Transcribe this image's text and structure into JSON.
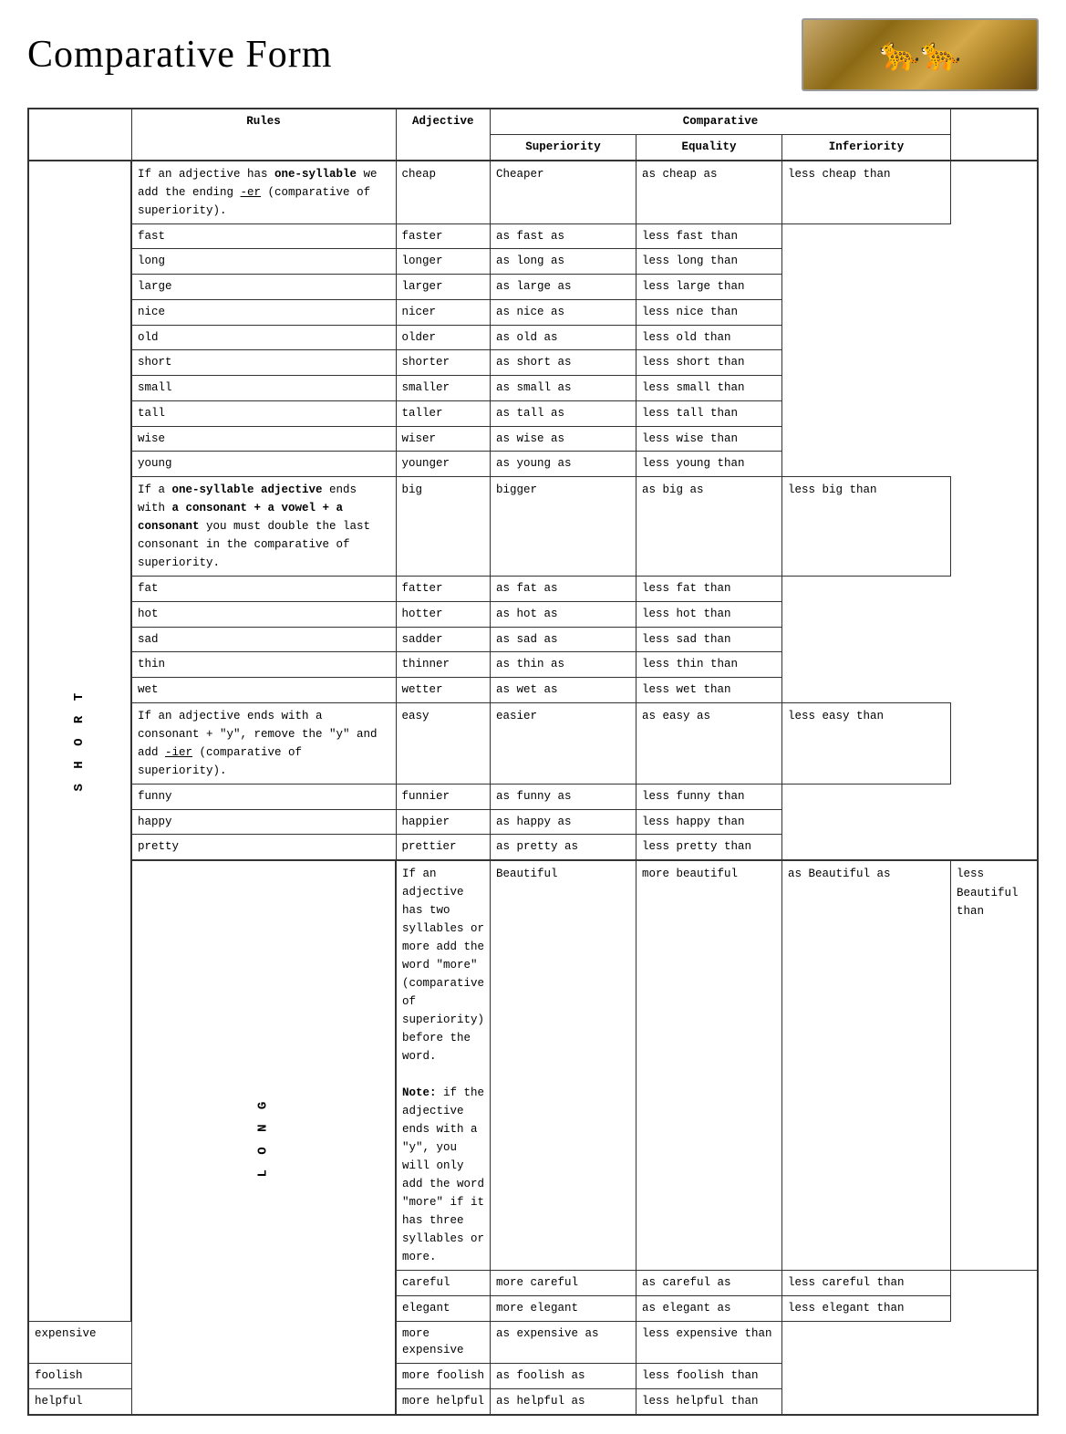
{
  "title": "Comparative Form",
  "headers": {
    "rules": "Rules",
    "adjective": "Adjective",
    "comparative": "Comparative",
    "superiority": "Superiority",
    "equality": "Equality",
    "inferiority": "Inferiority"
  },
  "sections": {
    "short_label": "S\nH\nO\nR\nT",
    "long_label": "L\nO\nN\nG"
  },
  "rows": [
    {
      "section": "SHORT",
      "rule": "If an adjective has <b>one-syllable</b> we add the ending <u>-er</u> (comparative of superiority).",
      "adjectives": [
        "cheap",
        "fast",
        "long",
        "large",
        "nice",
        "old",
        "short",
        "small",
        "tall",
        "wise",
        "young"
      ],
      "superiority": [
        "Cheaper",
        "faster",
        "longer",
        "larger",
        "nicer",
        "older",
        "shorter",
        "smaller",
        "taller",
        "wiser",
        "younger"
      ],
      "equality": [
        "as cheap as",
        "as fast as",
        "as long as",
        "as large as",
        "as nice as",
        "as old as",
        "as short as",
        "as small as",
        "as tall as",
        "as wise as",
        "as young as"
      ],
      "inferiority": [
        "less cheap than",
        "less fast than",
        "less long than",
        "less large than",
        "less nice than",
        "less old than",
        "less short than",
        "less small than",
        "less tall than",
        "less wise than",
        "less young than"
      ]
    },
    {
      "section": "SHORT",
      "rule": "If a <b>one-syllable adjective</b> ends with <b>a consonant + a vowel + a consonant</b> you must double the last consonant in the comparative of superiority.",
      "adjectives": [
        "big",
        "fat",
        "hot",
        "sad",
        "thin",
        "wet"
      ],
      "superiority": [
        "bigger",
        "fatter",
        "hotter",
        "sadder",
        "thinner",
        "wetter"
      ],
      "equality": [
        "as big as",
        "as fat as",
        "as hot as",
        "as sad as",
        "as thin as",
        "as wet as"
      ],
      "inferiority": [
        "less big than",
        "less fat than",
        "less hot than",
        "less sad than",
        "less thin than",
        "less wet than"
      ]
    },
    {
      "section": "SHORT",
      "rule": "If an adjective ends with a consonant + \"y\", remove the \"y\" and add <u>-ier</u> (comparative of superiority).",
      "adjectives": [
        "easy",
        "funny",
        "happy",
        "pretty"
      ],
      "superiority": [
        "easier",
        "funnier",
        "happier",
        "prettier"
      ],
      "equality": [
        "as easy as",
        "as funny as",
        "as happy as",
        "as pretty as"
      ],
      "inferiority": [
        "less easy than",
        "less funny than",
        "less happy than",
        "less pretty than"
      ]
    },
    {
      "section": "LONG",
      "rule": "If an adjective has two syllables or more add the word \"more\" (comparative of superiority) before the word.\n\n<b>Note:</b> if the adjective ends with a \"y\", you will only add the word \"more\" if it has three syllables or more.",
      "adjectives": [
        "Beautiful",
        "careful",
        "elegant",
        "expensive",
        "foolish",
        "helpful"
      ],
      "superiority": [
        "more beautiful",
        "more careful",
        "more elegant",
        "more expensive",
        "more foolish",
        "more helpful"
      ],
      "equality": [
        "as Beautiful as",
        "as careful as",
        "as elegant as",
        "as expensive as",
        "as foolish as",
        "as helpful as"
      ],
      "inferiority": [
        "less Beautiful than",
        "less careful than",
        "less elegant than",
        "less expensive than",
        "less foolish than",
        "less helpful than"
      ]
    }
  ]
}
